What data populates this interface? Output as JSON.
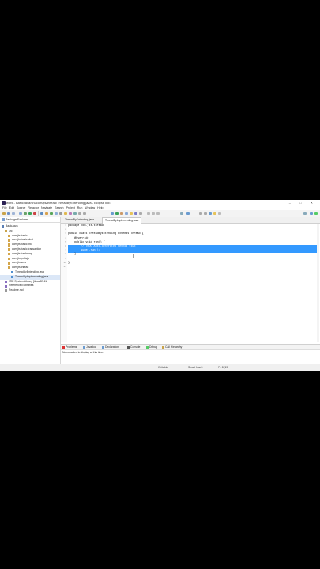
{
  "window": {
    "title": "work - BasicJava/src/com/jts/thread/ThreadByExtending.java - Eclipse IDE",
    "controls": "– □ ✕"
  },
  "menu": [
    "File",
    "Edit",
    "Source",
    "Refactor",
    "Navigate",
    "Search",
    "Project",
    "Run",
    "Window",
    "Help"
  ],
  "package_explorer": {
    "tab_label": "Package Explorer",
    "items": [
      {
        "label": "BasicJava",
        "indent": 0,
        "icon": "project-icon"
      },
      {
        "label": "src",
        "indent": 1,
        "icon": "source-folder-icon"
      },
      {
        "label": "com.jts.basic",
        "indent": 2,
        "icon": "package-icon"
      },
      {
        "label": "com.jts.basic.abst",
        "indent": 2,
        "icon": "package-icon"
      },
      {
        "label": "com.jts.basic.lnk",
        "indent": 2,
        "icon": "package-icon"
      },
      {
        "label": "com.jts.basic.transaction",
        "indent": 2,
        "icon": "package-icon"
      },
      {
        "label": "com.jts.hashmap",
        "indent": 2,
        "icon": "package-icon"
      },
      {
        "label": "com.jts.polfaja",
        "indent": 2,
        "icon": "package-icon"
      },
      {
        "label": "com.jts.sms",
        "indent": 2,
        "icon": "package-icon"
      },
      {
        "label": "com.jts.thread",
        "indent": 2,
        "icon": "package-icon"
      },
      {
        "label": "ThreadByExtending.java",
        "indent": 3,
        "icon": "java-file-icon"
      },
      {
        "label": "ThreadByImplementing.java",
        "indent": 3,
        "icon": "java-file-icon",
        "selected": true
      },
      {
        "label": "JRE System Library [JavaSE-11]",
        "indent": 1,
        "icon": "library-icon"
      },
      {
        "label": "Referenced Libraries",
        "indent": 1,
        "icon": "library-icon"
      },
      {
        "label": "Readme.md",
        "indent": 1,
        "icon": "file-icon"
      }
    ]
  },
  "editor": {
    "tabs": [
      {
        "label": "ThreadByExtending.java",
        "active": false
      },
      {
        "label": "ThreadByImplementing.java",
        "active": true
      }
    ],
    "lines": [
      {
        "n": "1",
        "text": "package com.jts.thread;"
      },
      {
        "n": "2",
        "text": ""
      },
      {
        "n": "3",
        "text": "public class ThreadByExtending extends Thread {"
      },
      {
        "n": "4",
        "text": "    @Override"
      },
      {
        "n": "5",
        "text": "    public void run() {"
      },
      {
        "n": "6",
        "text": "        // TODO Auto-generated method stub",
        "highlight": true
      },
      {
        "n": "7",
        "text": "        super.run();",
        "highlight": true
      },
      {
        "n": "8",
        "text": "    }"
      },
      {
        "n": "9",
        "text": ""
      },
      {
        "n": "10",
        "text": "}"
      },
      {
        "n": "11",
        "text": ""
      }
    ]
  },
  "bottom_panel": {
    "tabs": [
      "Problems",
      "Javadoc",
      "Declaration",
      "Console",
      "Debug",
      "Call Hierarchy"
    ],
    "message": "No consoles to display at this time."
  },
  "status": {
    "writable": "Writable",
    "insert_mode": "Smart Insert",
    "position": "7 : 8 [19]"
  },
  "colors": {
    "selection": "#3399ff",
    "keyword": "#7f0055",
    "annotation": "#646464"
  }
}
